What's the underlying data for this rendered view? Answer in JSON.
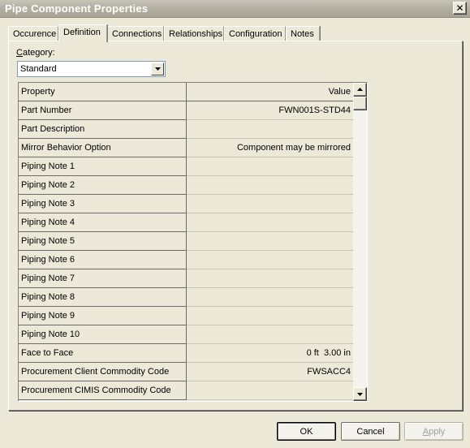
{
  "window": {
    "title": "Pipe Component Properties"
  },
  "tabs": [
    {
      "label": "Occurence",
      "active": false
    },
    {
      "label": "Definition",
      "active": true
    },
    {
      "label": "Connections",
      "active": false
    },
    {
      "label": "Relationships",
      "active": false
    },
    {
      "label": "Configuration",
      "active": false
    },
    {
      "label": "Notes",
      "active": false
    }
  ],
  "category": {
    "label_first": "C",
    "label_rest": "ategory:",
    "value": "Standard"
  },
  "grid": {
    "headers": {
      "property": "Property",
      "value": "Value"
    },
    "rows": [
      {
        "property": "Part Number",
        "value": "FWN001S-STD44"
      },
      {
        "property": "Part Description",
        "value": ""
      },
      {
        "property": "Mirror Behavior Option",
        "value": "Component may be mirrored"
      },
      {
        "property": "Piping Note 1",
        "value": ""
      },
      {
        "property": "Piping Note 2",
        "value": ""
      },
      {
        "property": "Piping Note 3",
        "value": ""
      },
      {
        "property": "Piping Note 4",
        "value": ""
      },
      {
        "property": "Piping Note 5",
        "value": ""
      },
      {
        "property": "Piping Note 6",
        "value": ""
      },
      {
        "property": "Piping Note 7",
        "value": ""
      },
      {
        "property": "Piping Note 8",
        "value": ""
      },
      {
        "property": "Piping Note 9",
        "value": ""
      },
      {
        "property": "Piping Note 10",
        "value": ""
      },
      {
        "property": "Face to Face",
        "value": "0 ft  3.00 in"
      },
      {
        "property": "Procurement Client Commodity Code",
        "value": "FWSACC4"
      },
      {
        "property": "Procurement CIMIS Commodity Code",
        "value": ""
      }
    ]
  },
  "buttons": {
    "ok": "OK",
    "cancel": "Cancel",
    "apply_first": "A",
    "apply_rest": "pply"
  },
  "colors": {
    "dialog_bg": "#ece9d8",
    "inactive_title": "#b3b0a2",
    "disabled_text": "#a0a0a0"
  }
}
